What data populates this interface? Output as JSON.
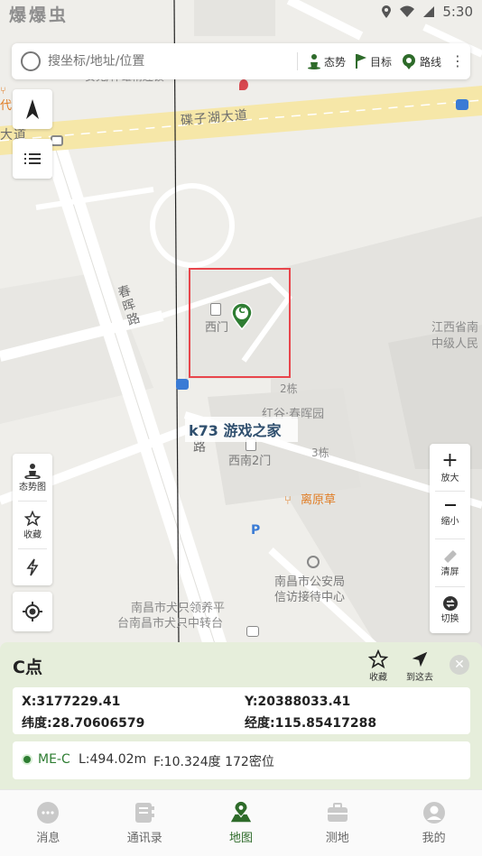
{
  "status_bar": {
    "app_name": "爆爆虫",
    "time": "5:30"
  },
  "search": {
    "placeholder": "搜坐标/地址/位置",
    "actions": [
      {
        "label": "态势",
        "icon": "person-pin-icon"
      },
      {
        "label": "目标",
        "icon": "flag-icon"
      },
      {
        "label": "路线",
        "icon": "route-pin-icon"
      }
    ]
  },
  "map": {
    "labels": {
      "road_main": "碟子湖大道",
      "road_main_left": "大道",
      "road_side": "春晖路",
      "road_side_lower": "路",
      "gate_west": "西门",
      "building_2": "2栋",
      "building_3": "3栋",
      "garden": "红谷·春晖园",
      "gate_sw2": "西南2门",
      "restaurant": "离原草",
      "police_1": "南昌市公安局",
      "police_2": "信访接待中心",
      "station_1": "南昌市犬只领养平",
      "station_2": "台南昌市犬只中转台",
      "right_1": "江西省南",
      "right_2": "中级人民",
      "top_cut": "·安苑/佯雄精连锁",
      "left_cut": "代"
    },
    "marker_letter": "C",
    "watermark": "k73 游戏之家"
  },
  "left_controls": {
    "situation_label": "态势图",
    "favorite_label": "收藏"
  },
  "right_controls": {
    "zoom_in_label": "放大",
    "zoom_out_label": "缩小",
    "clear_label": "清屏",
    "switch_label": "切换"
  },
  "point_panel": {
    "title": "C点",
    "favorite_label": "收藏",
    "goto_label": "到这去",
    "x_label": "X:3177229.41",
    "y_label": "Y:20388033.41",
    "lat_label": "纬度:28.70606579",
    "lon_label": "经度:115.85417288",
    "me_name": "ME-C",
    "distance": "L:494.02m",
    "bearing": "F:10.324度 172密位"
  },
  "bottom_nav": {
    "items": [
      {
        "label": "消息",
        "icon": "chat-bubble-icon",
        "active": false
      },
      {
        "label": "通讯录",
        "icon": "contacts-icon",
        "active": false
      },
      {
        "label": "地图",
        "icon": "map-pin-icon",
        "active": true
      },
      {
        "label": "测地",
        "icon": "briefcase-icon",
        "active": false
      },
      {
        "label": "我的",
        "icon": "user-icon",
        "active": false
      }
    ]
  },
  "colors": {
    "accent": "#2e6b2a",
    "panel_bg": "#e6eedb",
    "selection": "#e8454b",
    "road_yellow": "#f6e7a8"
  }
}
